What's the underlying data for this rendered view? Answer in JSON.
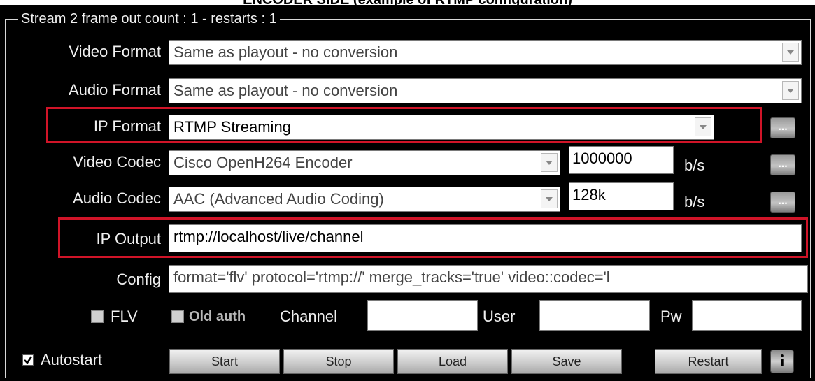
{
  "caption": "ENCODER SIDE (example of RTMP configuration)",
  "group_title": "Stream 2 frame out count : 1 - restarts : 1",
  "video_format": {
    "label": "Video Format",
    "value": "Same as playout - no conversion"
  },
  "audio_format": {
    "label": "Audio Format",
    "value": "Same as playout - no conversion"
  },
  "ip_format": {
    "label": "IP Format",
    "value": "RTMP Streaming",
    "more": "..."
  },
  "video_codec": {
    "label": "Video Codec",
    "value": "Cisco OpenH264 Encoder",
    "bitrate": "1000000",
    "unit": "b/s",
    "more": "..."
  },
  "audio_codec": {
    "label": "Audio Codec",
    "value": "AAC (Advanced Audio Coding)",
    "bitrate": "128k",
    "unit": "b/s",
    "more": "..."
  },
  "ip_output": {
    "label": "IP Output",
    "value": "rtmp://localhost/live/channel"
  },
  "config": {
    "label": "Config",
    "value": "format='flv' protocol='rtmp://' merge_tracks='true' video::codec='l"
  },
  "options": {
    "flv": {
      "label": "FLV",
      "checked": false
    },
    "old_auth": {
      "label": "Old auth",
      "checked": false
    },
    "channel_label": "Channel",
    "channel_value": "",
    "user_label": "User",
    "user_value": "",
    "pw_label": "Pw",
    "pw_value": ""
  },
  "autostart": {
    "label": "Autostart",
    "checked": true
  },
  "buttons": {
    "start": "Start",
    "stop": "Stop",
    "load": "Load",
    "save": "Save",
    "restart": "Restart",
    "info": "i"
  },
  "colors": {
    "panel_bg": "#000000",
    "label_text": "#f0f0f0",
    "highlight": "#d01428"
  }
}
